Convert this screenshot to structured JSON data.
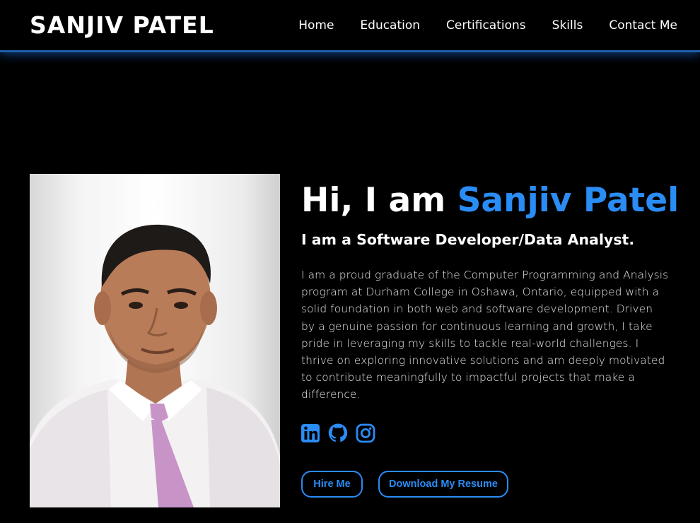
{
  "header": {
    "brand": "SANJIV PATEL",
    "nav": [
      "Home",
      "Education",
      "Certifications",
      "Skills",
      "Contact Me"
    ]
  },
  "hero": {
    "greeting": "Hi, I am ",
    "name": "Sanjiv Patel",
    "subtitle": "I am a Software Developer/Data Analyst.",
    "bio": "I am a proud graduate of the Computer Programming and Analysis program at Durham College in Oshawa, Ontario, equipped with a solid foundation in both web and software development. Driven by a genuine passion for continuous learning and growth, I take pride in leveraging my skills to tackle real-world challenges. I thrive on exploring innovative solutions and am deeply motivated to contribute meaningfully to impactful projects that make a difference.",
    "socials": [
      "linkedin-icon",
      "github-icon",
      "instagram-icon"
    ],
    "buttons": {
      "hire": "Hire Me",
      "resume": "Download My Resume"
    }
  },
  "colors": {
    "accent": "#2a8cf5",
    "background": "#000000",
    "nav_glow": "#1f5fa8"
  }
}
